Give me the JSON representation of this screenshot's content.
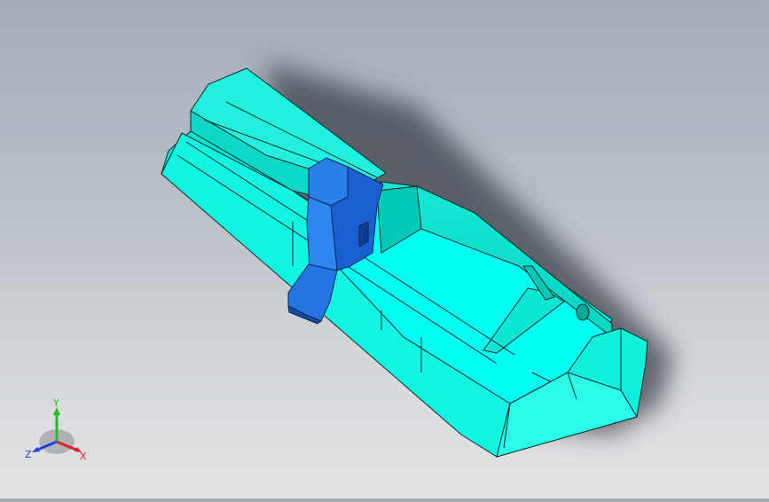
{
  "viewport": {
    "background_top": "#a4acb7",
    "background_bottom": "#e2e3e4"
  },
  "model": {
    "part_color": "#00ffe6",
    "part_shadow_color": "#00c8b4",
    "clip_color": "#1e73e6",
    "edge_color": "#0a2a2a"
  },
  "triad": {
    "x_label": "X",
    "y_label": "Y",
    "z_label": "Z",
    "x_color": "#e02020",
    "y_color": "#20c020",
    "z_color": "#2040e0"
  }
}
